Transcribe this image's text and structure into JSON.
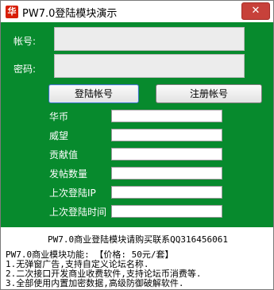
{
  "window": {
    "title": "PW7.0登陆模块演示",
    "close_symbol": "✕",
    "app_icon_glyph": "华"
  },
  "login": {
    "account_label": "帐号:",
    "account_value": "",
    "password_label": "密码:",
    "password_value": "",
    "login_button": "登陆帐号",
    "register_button": "注册帐号"
  },
  "info": {
    "fields": [
      {
        "label": "华币",
        "value": ""
      },
      {
        "label": "威望",
        "value": ""
      },
      {
        "label": "贡献值",
        "value": ""
      },
      {
        "label": "发帖数量",
        "value": ""
      },
      {
        "label": "上次登陆IP",
        "value": ""
      },
      {
        "label": "上次登陆时间",
        "value": ""
      }
    ]
  },
  "footer": {
    "contact": "PW7.0商业登陆模块请购买联系QQ316456061",
    "features_title": "PW7.0商业模块功能: 【价格: 50元/套】",
    "features": [
      "1.无弹窗广告,支持自定义论坛名称.",
      "2.二次接口开发商业收费软件,支持论坛币消费等.",
      "3.全部使用内置加密数据,高级防御破解软件."
    ]
  },
  "colors": {
    "panel_bg": "#078a2d",
    "close_bg": "#c7413a"
  }
}
